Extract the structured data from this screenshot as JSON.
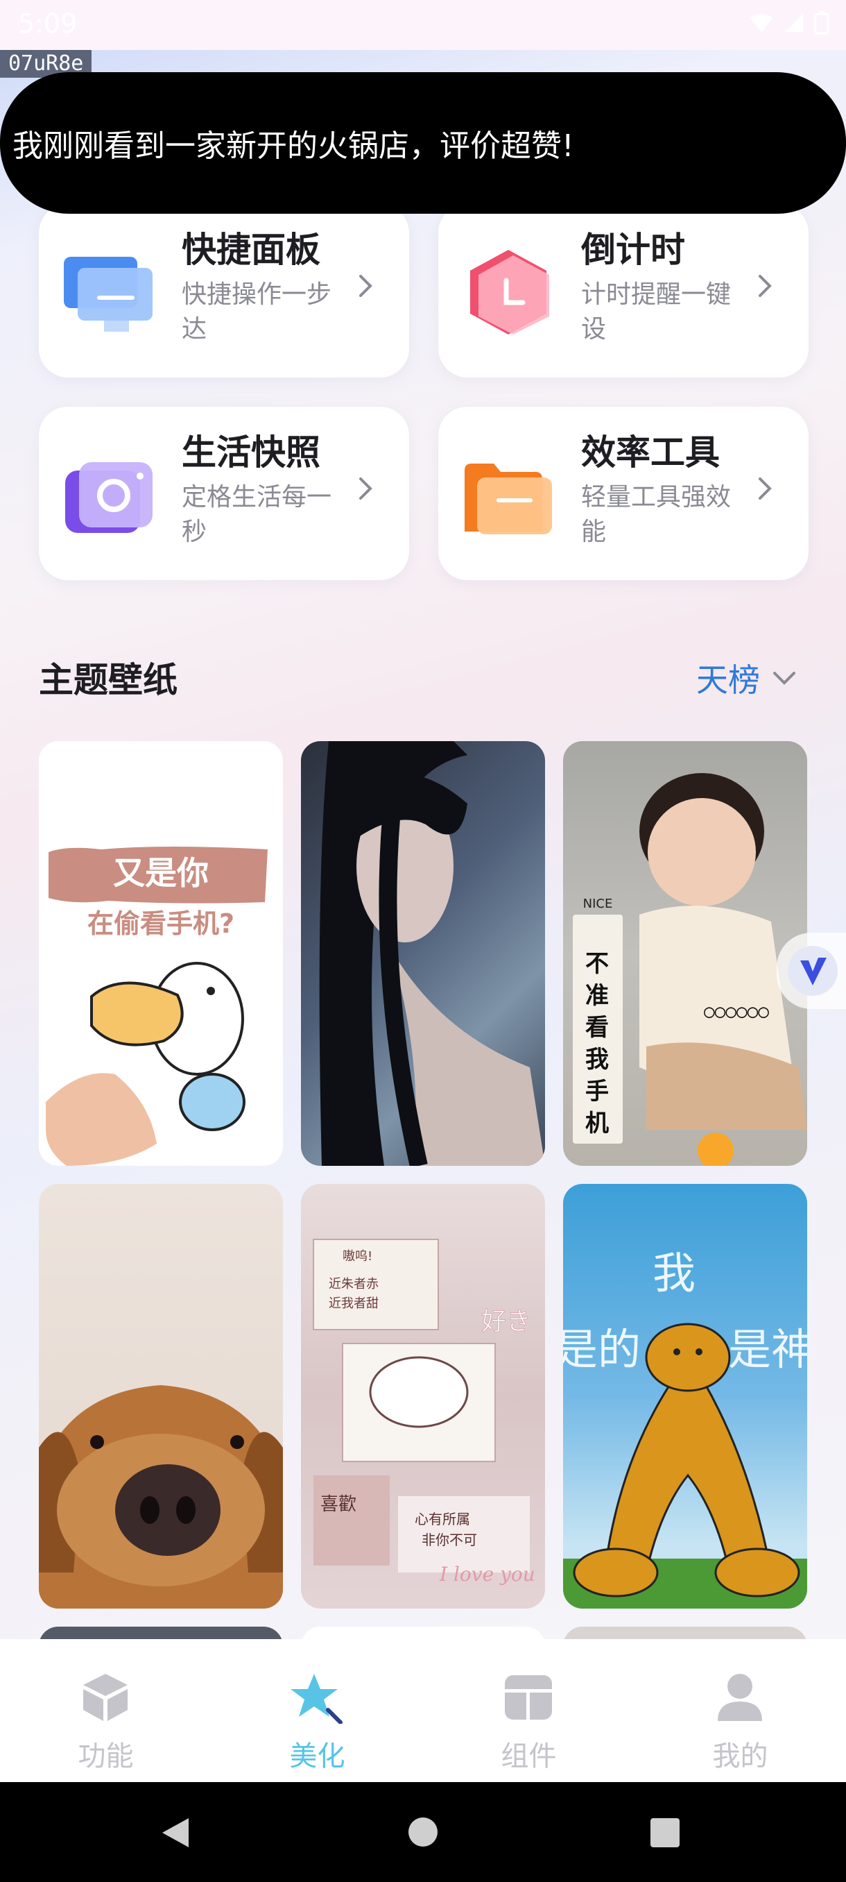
{
  "status_bar": {
    "time": "5:09"
  },
  "app_id_label": "07uR8e",
  "toast": {
    "text": "我刚刚看到一家新开的火锅店，评价超赞!"
  },
  "cards": [
    {
      "title": "快捷面板",
      "subtitle": "快捷操作一步达",
      "icon": "monitor-icon"
    },
    {
      "title": "倒计时",
      "subtitle": "计时提醒一键设",
      "icon": "clock-hexagon-icon"
    },
    {
      "title": "生活快照",
      "subtitle": "定格生活每一秒",
      "icon": "camera-icon"
    },
    {
      "title": "效率工具",
      "subtitle": "轻量工具强效能",
      "icon": "folder-icon"
    }
  ],
  "wallpapers": {
    "title": "主题壁纸",
    "ranking_label": "天榜",
    "items": [
      {
        "name": "duck-pointing-wallpaper",
        "line1": "又是你",
        "line2": "在偷看手机?"
      },
      {
        "name": "girl-portrait-wallpaper"
      },
      {
        "name": "baby-nice-wallpaper",
        "badge": "NICE",
        "vertical_text": "不准看我手机",
        "dots": "○○○○○○"
      },
      {
        "name": "golden-retriever-wallpaper"
      },
      {
        "name": "cute-cat-collage-wallpaper",
        "t1": "嗷呜!",
        "t2": "近朱者赤",
        "t3": "近我者甜",
        "t4": "好き",
        "t5": "喜歡",
        "t6": "心有所属",
        "t7": "非你不可",
        "t8": "I love you"
      },
      {
        "name": "dog-god-wallpaper",
        "t1": "我",
        "t2": "是的",
        "t3": "是神"
      }
    ]
  },
  "bottom_nav": [
    {
      "label": "功能",
      "icon": "cube-icon",
      "active": false
    },
    {
      "label": "美化",
      "icon": "star-brush-icon",
      "active": true
    },
    {
      "label": "组件",
      "icon": "widget-icon",
      "active": false
    },
    {
      "label": "我的",
      "icon": "person-icon",
      "active": false
    }
  ],
  "colors": {
    "accent": "#57c4e6",
    "link": "#2f7ad9",
    "inactive": "#c4c4ca"
  }
}
